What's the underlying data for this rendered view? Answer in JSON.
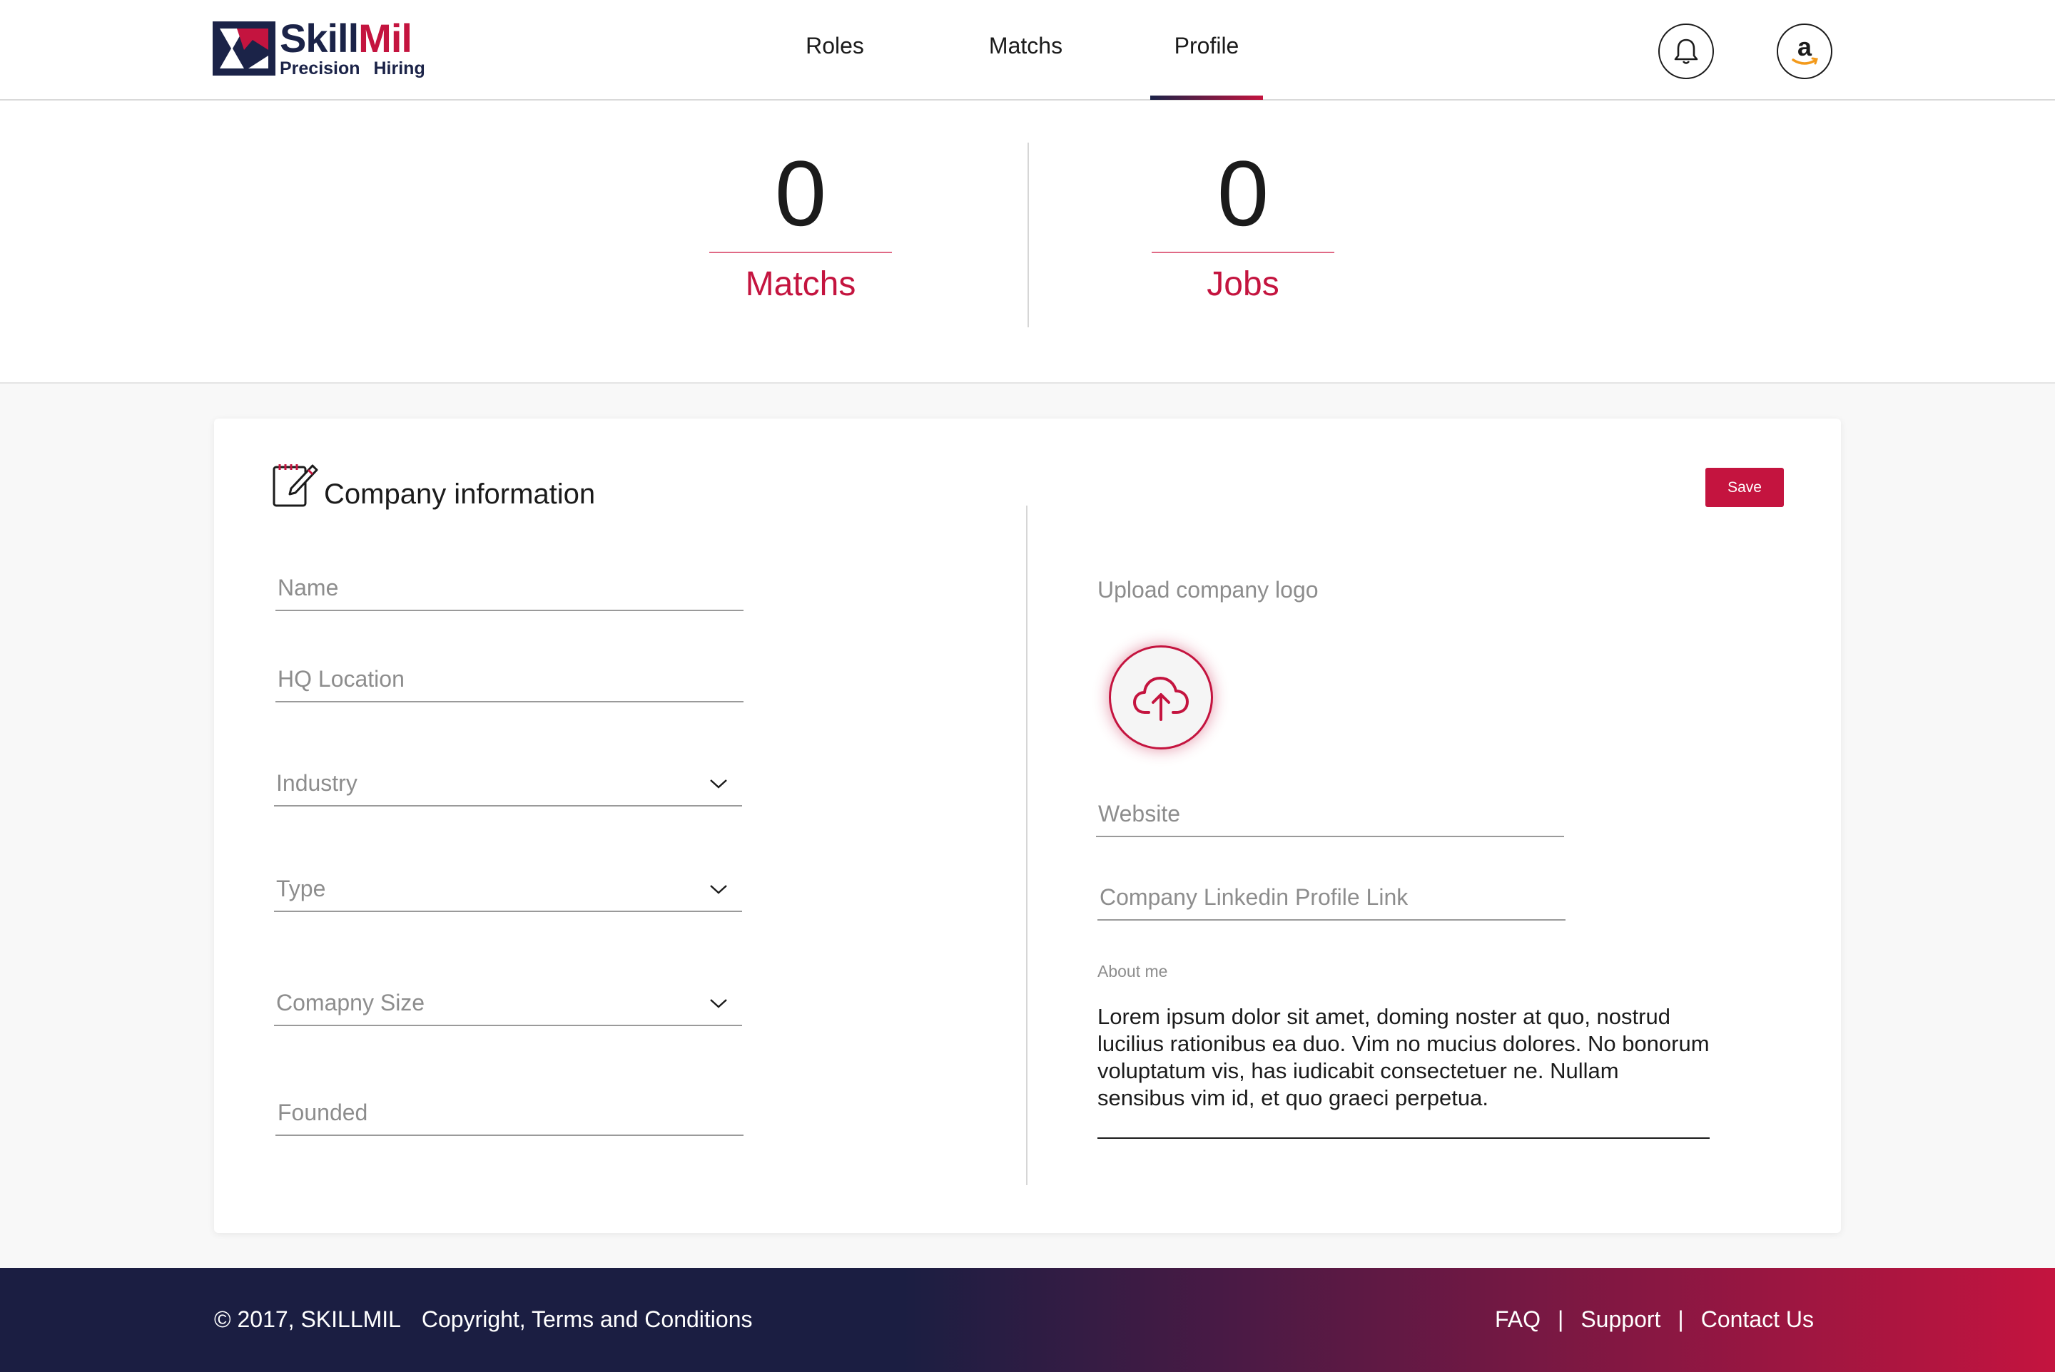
{
  "brand": {
    "name_part1": "Skill",
    "name_part2": "Mil",
    "tagline": "Precision Hiring"
  },
  "nav": {
    "items": [
      {
        "label": "Roles",
        "active": false
      },
      {
        "label": "Matchs",
        "active": false
      },
      {
        "label": "Profile",
        "active": true
      }
    ]
  },
  "header_icons": [
    "bell-icon",
    "amazon-logo-icon"
  ],
  "stats": {
    "matchs": {
      "value": "0",
      "label": "Matchs"
    },
    "jobs": {
      "value": "0",
      "label": "Jobs"
    }
  },
  "card": {
    "title": "Company information",
    "title_icon": "edit-notepad-icon",
    "save_label": "Save",
    "left_fields": {
      "name": {
        "placeholder": "Name"
      },
      "hq": {
        "placeholder": "HQ Location"
      },
      "industry": {
        "placeholder": "Industry"
      },
      "type": {
        "placeholder": "Type"
      },
      "size": {
        "placeholder": "Comapny Size"
      },
      "founded": {
        "placeholder": "Founded"
      }
    },
    "upload": {
      "label": "Upload company logo",
      "icon": "cloud-upload-icon"
    },
    "right_fields": {
      "website": {
        "placeholder": "Website"
      },
      "linkedin": {
        "placeholder": "Company Linkedin Profile Link"
      }
    },
    "about": {
      "label": "About me",
      "text": "Lorem ipsum dolor sit amet, doming noster at quo, nostrud lucilius rationibus ea duo. Vim no mucius dolores. No bonorum voluptatum vis, has iudicabit consectetuer ne. Nullam sensibus vim id, et quo graeci perpetua."
    }
  },
  "footer": {
    "copyright": "© 2017, SKILLMIL",
    "terms": "Copyright, Terms and Conditions",
    "links": [
      "FAQ",
      "Support",
      "Contact Us"
    ],
    "separator": "|"
  },
  "colors": {
    "brand_navy": "#1b2348",
    "brand_red": "#c4143f"
  }
}
